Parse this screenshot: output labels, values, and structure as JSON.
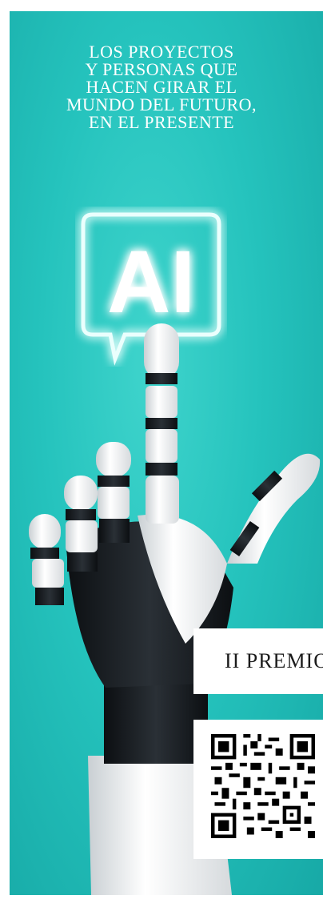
{
  "banner": {
    "headline_lines": [
      "LOS PROYECTOS",
      "Y PERSONAS QUE",
      "HACEN GIRAR EL",
      "MUNDO DEL FUTURO,",
      "EN EL PRESENTE"
    ],
    "ai_label": "AI",
    "premio_label": "II PREMIO",
    "colors": {
      "background": "#25c3bd",
      "text": "#ffffff",
      "ai_glow": "#eafffd"
    }
  }
}
